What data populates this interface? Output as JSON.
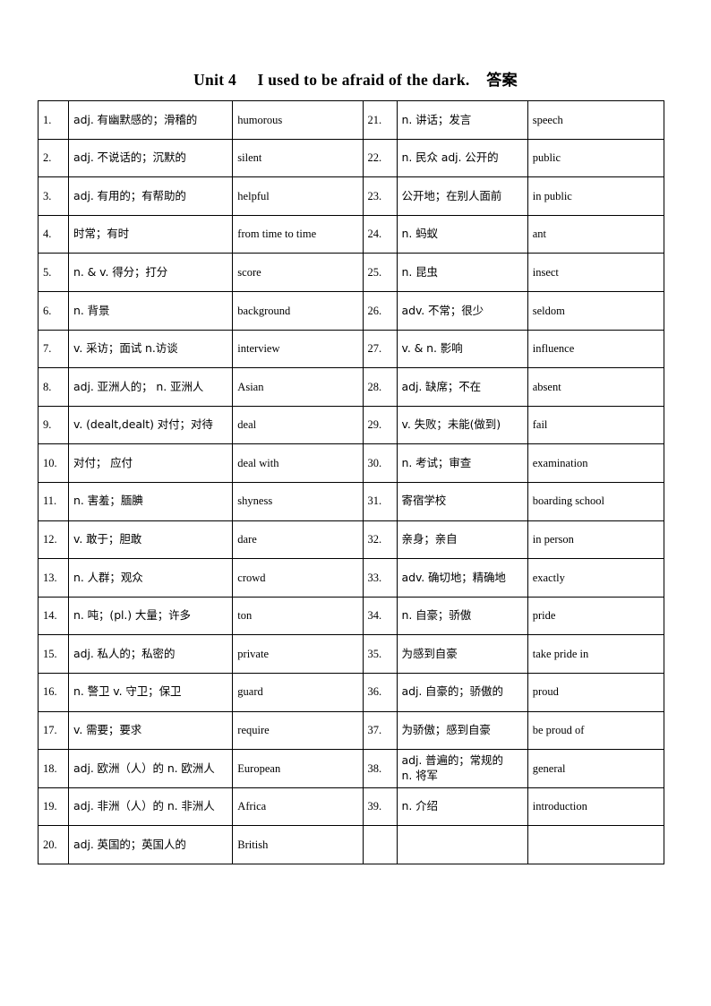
{
  "document": {
    "title_unit": "Unit 4",
    "title_en": "I used to be afraid of the dark.",
    "title_cn": "答案"
  },
  "table": {
    "left_column": [
      {
        "no": "1.",
        "cn": "adj. 有幽默感的；滑稽的",
        "en": "humorous"
      },
      {
        "no": "2.",
        "cn": "adj. 不说话的；沉默的",
        "en": "silent"
      },
      {
        "no": "3.",
        "cn": "adj. 有用的；有帮助的",
        "en": "helpful"
      },
      {
        "no": "4.",
        "cn": "时常；有时",
        "en": "from time to time"
      },
      {
        "no": "5.",
        "cn": "n. & v. 得分；打分",
        "en": "score"
      },
      {
        "no": "6.",
        "cn": "n. 背景",
        "en": "background"
      },
      {
        "no": "7.",
        "cn": "v. 采访；面试 n.访谈",
        "en": "interview"
      },
      {
        "no": "8.",
        "cn": "adj. 亚洲人的；  n. 亚洲人",
        "en": "Asian"
      },
      {
        "no": "9.",
        "cn": "v. (dealt,dealt) 对付；对待",
        "en": "deal"
      },
      {
        "no": "10.",
        "cn": "对付；  应付",
        "en": "deal with"
      },
      {
        "no": "11.",
        "cn": "n. 害羞；腼腆",
        "en": "shyness"
      },
      {
        "no": "12.",
        "cn": "v. 敢于；胆敢",
        "en": "dare"
      },
      {
        "no": "13.",
        "cn": "n. 人群；观众",
        "en": "crowd"
      },
      {
        "no": "14.",
        "cn": "n. 吨；(pl.) 大量；许多",
        "en": "ton"
      },
      {
        "no": "15.",
        "cn": "adj. 私人的；私密的",
        "en": "private"
      },
      {
        "no": "16.",
        "cn": "n. 警卫 v. 守卫；保卫",
        "en": "guard"
      },
      {
        "no": "17.",
        "cn": "v. 需要；要求",
        "en": "require"
      },
      {
        "no": "18.",
        "cn": "adj. 欧洲（人）的 n. 欧洲人",
        "en": "European"
      },
      {
        "no": "19.",
        "cn": "adj. 非洲（人）的 n. 非洲人",
        "en": "Africa"
      },
      {
        "no": "20.",
        "cn": "adj. 英国的；英国人的",
        "en": "British"
      }
    ],
    "right_column": [
      {
        "no": "21.",
        "cn": "n. 讲话；发言",
        "en": "speech"
      },
      {
        "no": "22.",
        "cn": "n. 民众 adj. 公开的",
        "en": "public"
      },
      {
        "no": "23.",
        "cn": "公开地；在别人面前",
        "en": "in public"
      },
      {
        "no": "24.",
        "cn": "n. 蚂蚁",
        "en": "ant"
      },
      {
        "no": "25.",
        "cn": "n. 昆虫",
        "en": "insect"
      },
      {
        "no": "26.",
        "cn": "adv. 不常；很少",
        "en": "seldom"
      },
      {
        "no": "27.",
        "cn": "v. & n. 影响",
        "en": "influence"
      },
      {
        "no": "28.",
        "cn": "adj. 缺席；不在",
        "en": "absent"
      },
      {
        "no": "29.",
        "cn": "v. 失败；未能(做到)",
        "en": "fail"
      },
      {
        "no": "30.",
        "cn": "n. 考试；审查",
        "en": "examination"
      },
      {
        "no": "31.",
        "cn": "寄宿学校",
        "en": "boarding school"
      },
      {
        "no": "32.",
        "cn": "亲身；亲自",
        "en": "in person"
      },
      {
        "no": "33.",
        "cn": "adv. 确切地；精确地",
        "en": "exactly"
      },
      {
        "no": "34.",
        "cn": "n. 自豪；骄傲",
        "en": "pride"
      },
      {
        "no": "35.",
        "cn": "为感到自豪",
        "en": "take pride in"
      },
      {
        "no": "36.",
        "cn": "adj. 自豪的；骄傲的",
        "en": "proud"
      },
      {
        "no": "37.",
        "cn": "为骄傲；感到自豪",
        "en": "be proud of"
      },
      {
        "no": "38.",
        "cn": "adj. 普遍的；常规的\nn. 将军",
        "en": "general"
      },
      {
        "no": "39.",
        "cn": "n. 介绍",
        "en": "introduction"
      },
      {
        "no": "",
        "cn": "",
        "en": ""
      }
    ]
  }
}
